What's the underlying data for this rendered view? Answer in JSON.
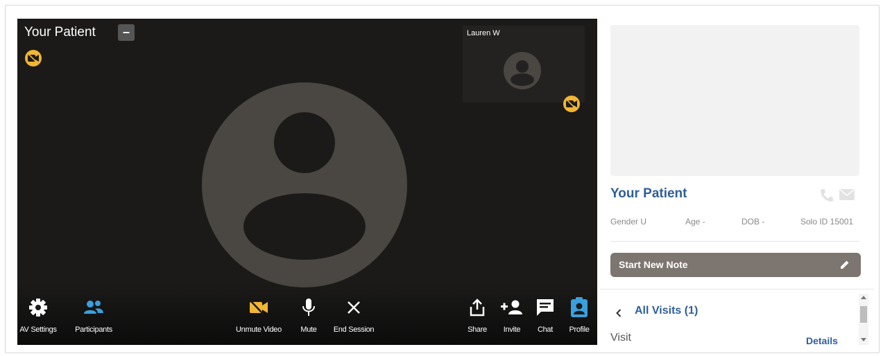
{
  "video": {
    "title": "Your Patient",
    "minimize_label": "–",
    "pip_name": "Lauren W"
  },
  "controls": {
    "av_settings": "AV Settings",
    "participants": "Participants",
    "unmute_video": "Unmute Video",
    "mute": "Mute",
    "end_session": "End Session",
    "share": "Share",
    "invite": "Invite",
    "chat": "Chat",
    "profile": "Profile"
  },
  "patient": {
    "name": "Your Patient",
    "gender": "Gender U",
    "age": "Age -",
    "dob": "DOB -",
    "solo_id": "Solo ID 15001"
  },
  "note": {
    "start_label": "Start New Note"
  },
  "visits": {
    "all_label": "All Visits (1)",
    "visit_label": "Visit",
    "details_label": "Details"
  },
  "icons": {
    "camera_off": "camera-off-icon",
    "avatar": "avatar-icon",
    "gear": "gear-icon",
    "participants": "participants-icon",
    "microphone": "microphone-icon",
    "close": "close-icon",
    "share": "share-icon",
    "invite": "add-person-icon",
    "chat": "chat-icon",
    "profile": "profile-icon",
    "phone": "phone-icon",
    "mail": "mail-icon",
    "pencil": "pencil-icon",
    "chevron_left": "chevron-left-icon"
  },
  "colors": {
    "video_bg": "#1b1a19",
    "accent_yellow": "#f2b632",
    "accent_blue": "#3aa0dd",
    "link_blue": "#2f5e99",
    "note_button": "#7d756f"
  }
}
